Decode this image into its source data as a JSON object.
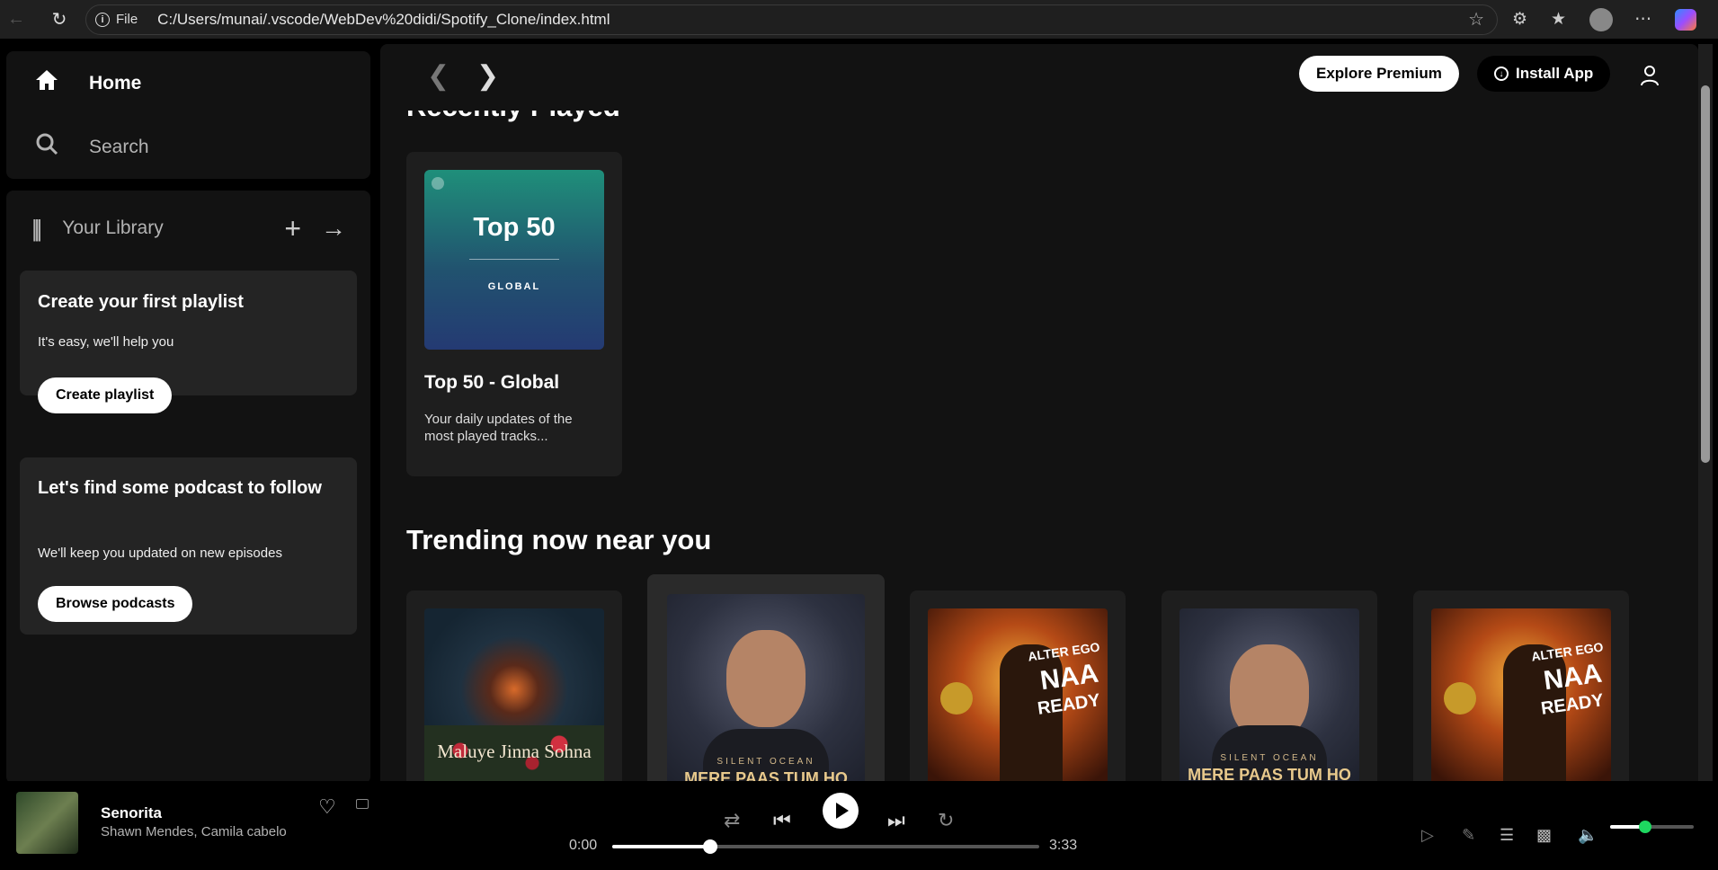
{
  "browser": {
    "scheme": "File",
    "url": "C:/Users/munai/.vscode/WebDev%20didi/Spotify_Clone/index.html"
  },
  "sidebar": {
    "home_label": "Home",
    "search_label": "Search",
    "library_label": "Your Library",
    "playlist_box": {
      "title": "Create your first playlist",
      "subtitle": "It's easy, we'll help you",
      "button": "Create playlist"
    },
    "podcast_box": {
      "title": "Let's find some podcast to follow",
      "subtitle": "We'll keep you updated on new episodes",
      "button": "Browse podcasts"
    }
  },
  "header": {
    "explore_label": "Explore Premium",
    "install_label": "Install App"
  },
  "recently_played": {
    "title": "Recently Played",
    "cards": [
      {
        "art_title": "Top 50",
        "art_subtitle": "GLOBAL",
        "title": "Top 50 - Global",
        "description": "Your daily updates of the most played tracks..."
      }
    ]
  },
  "trending": {
    "title": "Trending now near you",
    "cards": [
      {
        "art_text": "Maluye Jinna Sohna"
      },
      {
        "art_sub": "SILENT OCEAN",
        "art_text": "MERE PAAS TUM HO"
      },
      {
        "art_t1": "ALTER EGO",
        "art_t2": "NAA",
        "art_t3": "READY"
      },
      {
        "art_sub": "SILENT OCEAN",
        "art_text": "MERE PAAS TUM HO"
      },
      {
        "art_t1": "ALTER EGO",
        "art_t2": "NAA",
        "art_t3": "READY"
      }
    ]
  },
  "player": {
    "song": "Senorita",
    "artist": "Shawn Mendes, Camila cabelo",
    "current_time": "0:00",
    "total_time": "3:33",
    "progress_fraction": 0.23,
    "volume_fraction": 0.42
  },
  "colors": {
    "accent": "#1ed760",
    "panel": "#121212",
    "card": "#242424"
  }
}
